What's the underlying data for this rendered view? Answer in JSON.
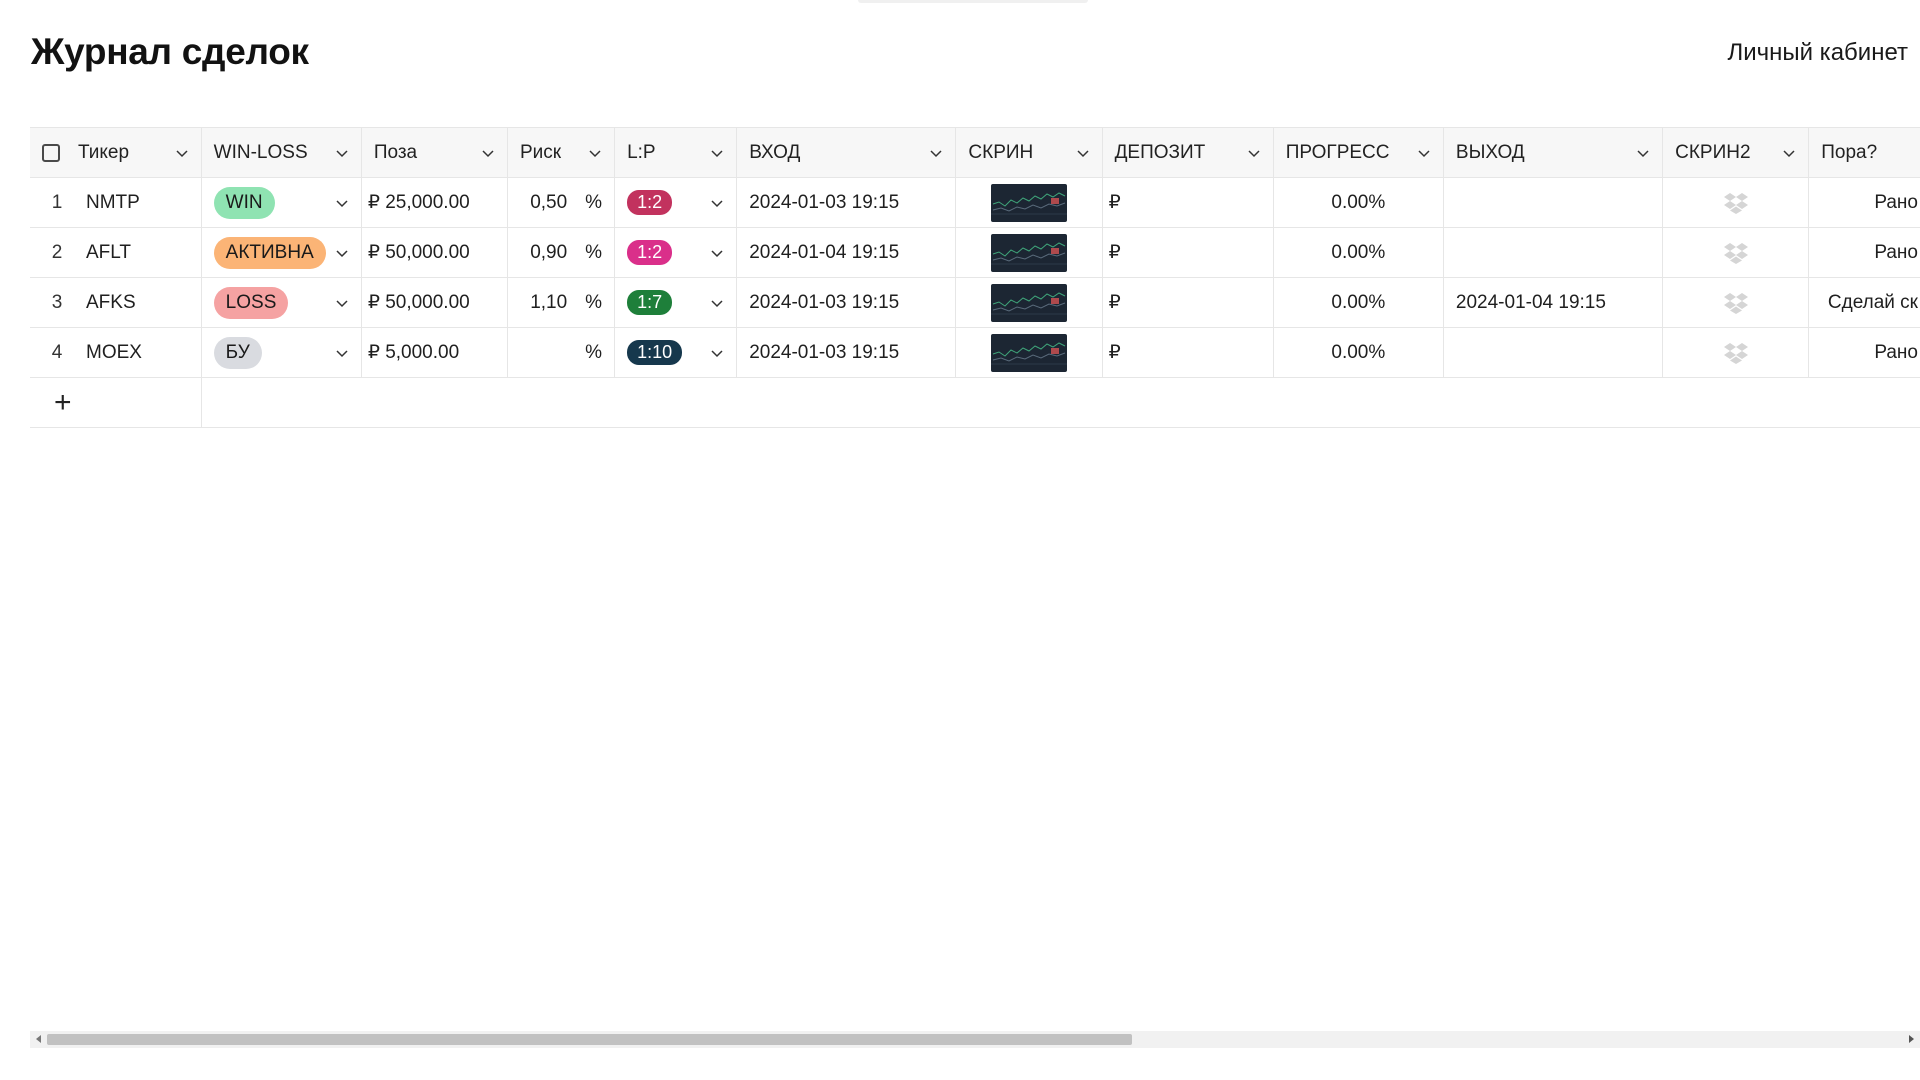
{
  "page": {
    "title": "Журнал сделок",
    "account_link": "Личный кабинет"
  },
  "table": {
    "columns": [
      "Тикер",
      "WIN-LOSS",
      "Поза",
      "Риск",
      "L:P",
      "ВХОД",
      "СКРИН",
      "ДЕПОЗИТ",
      "ПРОГРЕСС",
      "ВЫХОД",
      "СКРИН2",
      "Пора?"
    ],
    "rows": [
      {
        "n": "1",
        "ticker": "NMTP",
        "winloss": "WIN",
        "winloss_color": "#8fe3b2",
        "poza": "₽ 25,000.00",
        "risk": "0,50",
        "pct": "%",
        "lp": "1:2",
        "lp_color": "#c2325e",
        "entry": "2024-01-03 19:15",
        "deposit": "₽",
        "progress": "0.00%",
        "exit": "",
        "pora": "Рано"
      },
      {
        "n": "2",
        "ticker": "AFLT",
        "winloss": "АКТИВНА",
        "winloss_color": "#fbb476",
        "poza": "₽ 50,000.00",
        "risk": "0,90",
        "pct": "%",
        "lp": "1:2",
        "lp_color": "#da2f8a",
        "entry": "2024-01-04 19:15",
        "deposit": "₽",
        "progress": "0.00%",
        "exit": "",
        "pora": "Рано"
      },
      {
        "n": "3",
        "ticker": "AFKS",
        "winloss": "LOSS",
        "winloss_color": "#f5a2a2",
        "poza": "₽ 50,000.00",
        "risk": "1,10",
        "pct": "%",
        "lp": "1:7",
        "lp_color": "#1e7f3a",
        "entry": "2024-01-03 19:15",
        "deposit": "₽",
        "progress": "0.00%",
        "exit": "2024-01-04 19:15",
        "pora": "Сделай ск"
      },
      {
        "n": "4",
        "ticker": "MOEX",
        "winloss": "БУ",
        "winloss_color": "#d9dbe0",
        "poza": "₽ 5,000.00",
        "risk": "",
        "pct": "%",
        "lp": "1:10",
        "lp_color": "#16384d",
        "entry": "2024-01-03 19:15",
        "deposit": "₽",
        "progress": "0.00%",
        "exit": "",
        "pora": "Рано"
      }
    ],
    "add_row_label": "+"
  },
  "icons": {
    "chevron": "chevron-down-icon",
    "screenshot_placeholder": "dropbox-icon",
    "add": "plus-icon"
  },
  "colors": {
    "header_bg": "#f7f7f7",
    "border": "#e6e6e6",
    "thumb_bg": "#1c2633"
  }
}
